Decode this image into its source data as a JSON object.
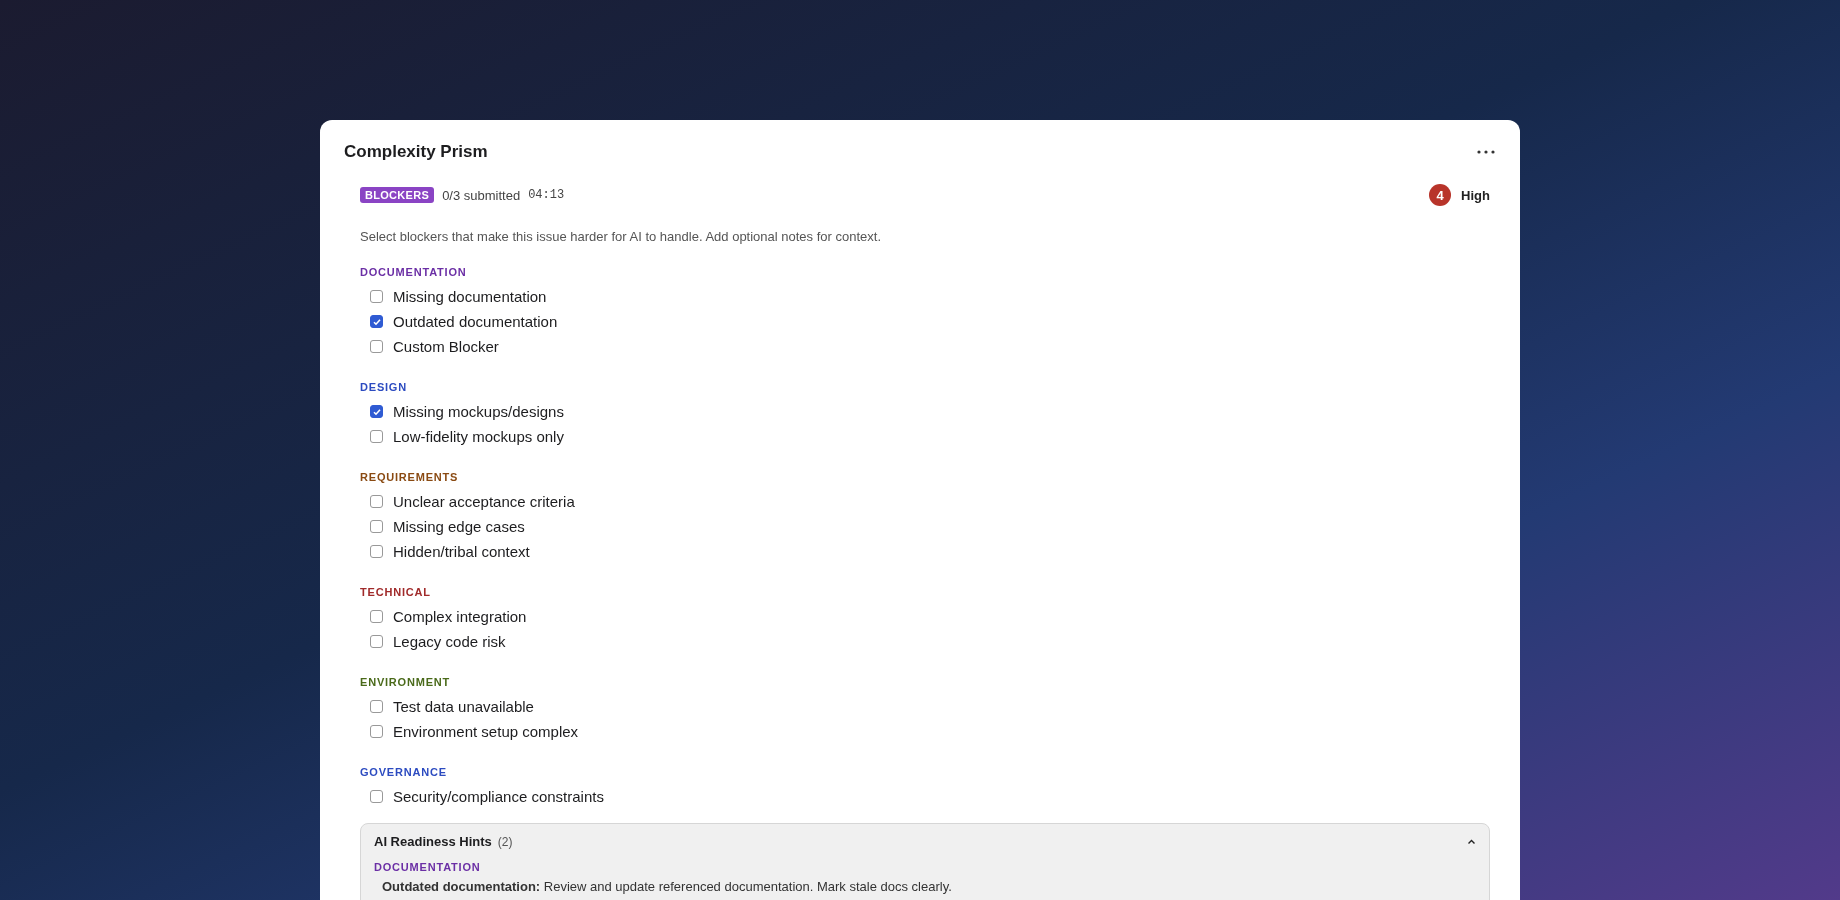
{
  "card": {
    "title": "Complexity Prism"
  },
  "meta": {
    "tag": "BLOCKERS",
    "submitted": "0/3 submitted",
    "timer": "04:13",
    "score": "4",
    "score_label": "High"
  },
  "description": "Select blockers that make this issue harder for AI to handle. Add optional notes for context.",
  "sections": [
    {
      "title": "DOCUMENTATION",
      "color": "#6b2fa5",
      "items": [
        {
          "label": "Missing documentation",
          "checked": false
        },
        {
          "label": "Outdated documentation",
          "checked": true
        },
        {
          "label": "Custom Blocker",
          "checked": false
        }
      ]
    },
    {
      "title": "DESIGN",
      "color": "#2c4bc0",
      "items": [
        {
          "label": "Missing mockups/designs",
          "checked": true
        },
        {
          "label": "Low-fidelity mockups only",
          "checked": false
        }
      ]
    },
    {
      "title": "REQUIREMENTS",
      "color": "#8a4a12",
      "items": [
        {
          "label": "Unclear acceptance criteria",
          "checked": false
        },
        {
          "label": "Missing edge cases",
          "checked": false
        },
        {
          "label": "Hidden/tribal context",
          "checked": false
        }
      ]
    },
    {
      "title": "TECHNICAL",
      "color": "#a02a2a",
      "items": [
        {
          "label": "Complex integration",
          "checked": false
        },
        {
          "label": "Legacy code risk",
          "checked": false
        }
      ]
    },
    {
      "title": "ENVIRONMENT",
      "color": "#4a6a1a",
      "items": [
        {
          "label": "Test data unavailable",
          "checked": false
        },
        {
          "label": "Environment setup complex",
          "checked": false
        }
      ]
    },
    {
      "title": "GOVERNANCE",
      "color": "#2c4bc0",
      "items": [
        {
          "label": "Security/compliance constraints",
          "checked": false
        }
      ]
    }
  ],
  "hints": {
    "title": "AI Readiness Hints",
    "count": "(2)",
    "expanded": true,
    "groups": [
      {
        "title": "DOCUMENTATION",
        "color": "#6b2fa5",
        "text": "**Outdated documentation:** Review and update referenced documentation. Mark stale docs clearly."
      }
    ]
  }
}
